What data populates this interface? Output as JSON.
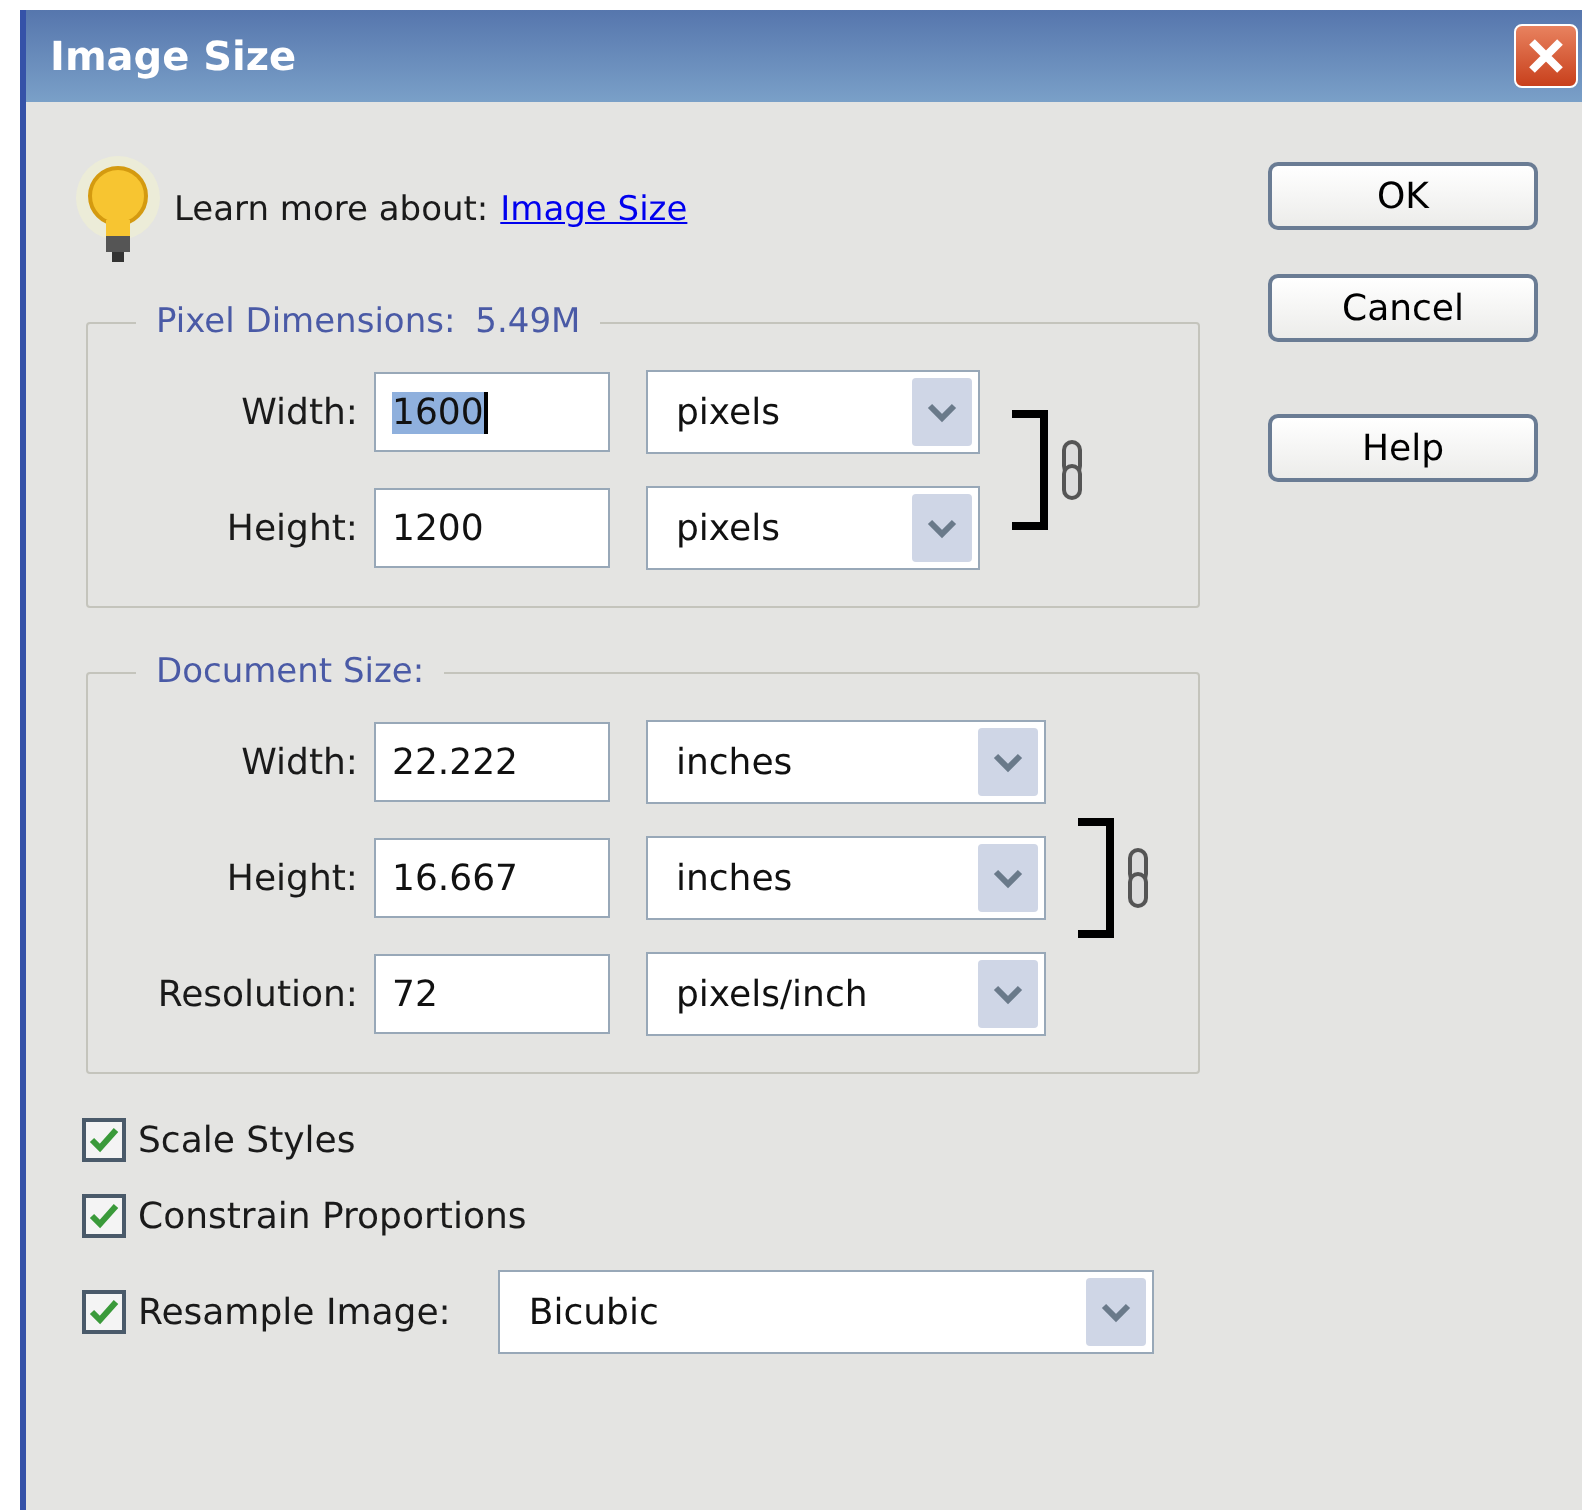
{
  "window": {
    "title": "Image Size"
  },
  "info": {
    "prefix": "Learn more about:",
    "link": "Image Size"
  },
  "pixel_dimensions": {
    "title": "Pixel Dimensions:",
    "value": "5.49M",
    "constrained": true,
    "fields": [
      {
        "label": "Width:",
        "value": "1600",
        "text_selected": true,
        "unit": "pixels"
      },
      {
        "label": "Height:",
        "value": "1200",
        "text_selected": false,
        "unit": "pixels"
      }
    ]
  },
  "document_size": {
    "title": "Document Size:",
    "constrained": true,
    "fields": [
      {
        "label": "Width:",
        "value": "22.222",
        "text_selected": false,
        "unit": "inches"
      },
      {
        "label": "Height:",
        "value": "16.667",
        "text_selected": false,
        "unit": "inches"
      },
      {
        "label": "Resolution:",
        "value": "72",
        "text_selected": false,
        "unit": "pixels/inch"
      }
    ]
  },
  "options": [
    {
      "label": "Scale Styles",
      "checked": true
    },
    {
      "label": "Constrain Proportions",
      "checked": true
    },
    {
      "label": "Resample Image:",
      "checked": true
    }
  ],
  "resample_method": "Bicubic",
  "buttons": [
    "OK",
    "Cancel",
    "Help"
  ]
}
